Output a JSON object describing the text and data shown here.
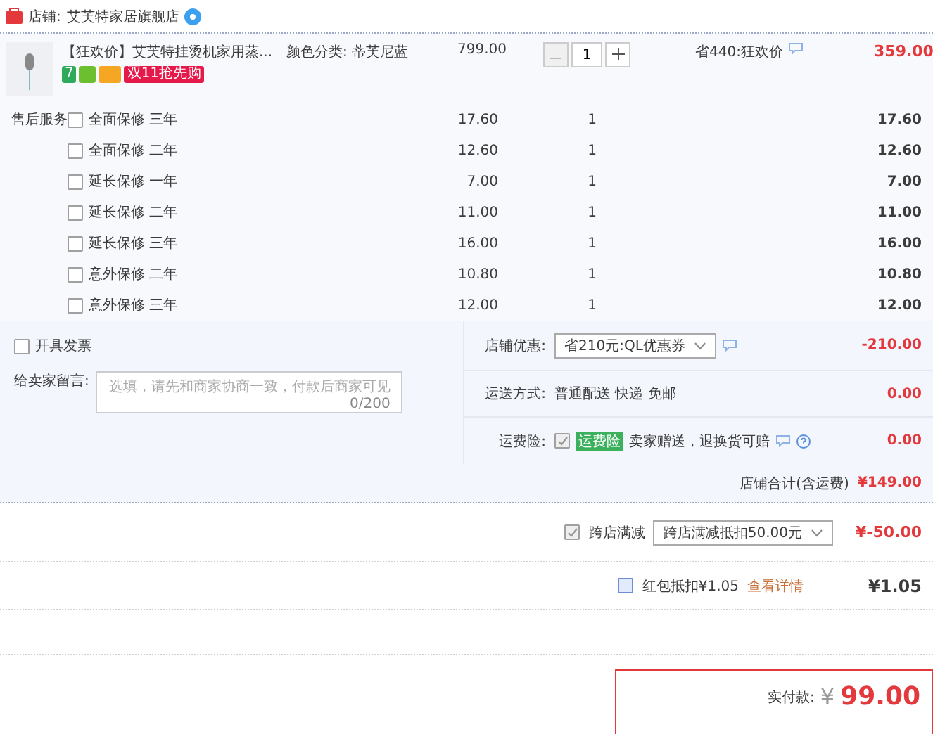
{
  "store": {
    "label": "店铺:",
    "name": "艾芙特家居旗舰店"
  },
  "product": {
    "title": "【狂欢价】艾芙特挂烫机家用蒸...",
    "spec": "颜色分类:  蒂芙尼蓝",
    "badges": [
      {
        "kind": "number",
        "text": "7",
        "color": "#2eaa5a"
      },
      {
        "kind": "icon",
        "color": "#6cbf2e"
      },
      {
        "kind": "card",
        "color": "#f5a623"
      },
      {
        "kind": "tag",
        "text": "双11抢先购",
        "color": "#e6194b"
      }
    ],
    "price": "799.00",
    "quantity": "1",
    "minus_disabled": true,
    "promo": "省440:狂欢价",
    "total": "359.00"
  },
  "services": {
    "label": "售后服务",
    "items": [
      {
        "name": "全面保修 三年",
        "price": "17.60",
        "quantity": "1",
        "total": "17.60",
        "checked": false
      },
      {
        "name": "全面保修 二年",
        "price": "12.60",
        "quantity": "1",
        "total": "12.60",
        "checked": false
      },
      {
        "name": "延长保修 一年",
        "price": "7.00",
        "quantity": "1",
        "total": "7.00",
        "checked": false
      },
      {
        "name": "延长保修 二年",
        "price": "11.00",
        "quantity": "1",
        "total": "11.00",
        "checked": false
      },
      {
        "name": "延长保修 三年",
        "price": "16.00",
        "quantity": "1",
        "total": "16.00",
        "checked": false
      },
      {
        "name": "意外保修 二年",
        "price": "10.80",
        "quantity": "1",
        "total": "10.80",
        "checked": false
      },
      {
        "name": "意外保修 三年",
        "price": "12.00",
        "quantity": "1",
        "total": "12.00",
        "checked": false
      }
    ]
  },
  "invoice": {
    "label": "开具发票",
    "checked": false
  },
  "message": {
    "label": "给卖家留言:",
    "placeholder": "选填，请先和商家协商一致，付款后商家可见",
    "counter": "0/200"
  },
  "store_discount": {
    "label": "店铺优惠:",
    "value": "省210元:QL优惠券",
    "amount": "-210.00"
  },
  "shipping": {
    "label": "运送方式:",
    "value": "普通配送 快递 免邮",
    "amount": "0.00"
  },
  "insurance": {
    "label": "运费险:",
    "checked": true,
    "tag": "运费险",
    "text": "卖家赠送，退换货可赔",
    "amount": "0.00"
  },
  "store_total": {
    "label": "店铺合计(含运费)",
    "amount": "¥149.00"
  },
  "cross_store": {
    "label": "跨店满减",
    "checked": true,
    "value": "跨店满减抵扣50.00元",
    "amount": "¥-50.00"
  },
  "red_packet": {
    "label": "红包抵扣¥1.05",
    "checked": false,
    "link": "查看详情",
    "amount": "¥1.05"
  },
  "payment": {
    "label": "实付款:",
    "currency": "¥",
    "amount": "99.00"
  }
}
